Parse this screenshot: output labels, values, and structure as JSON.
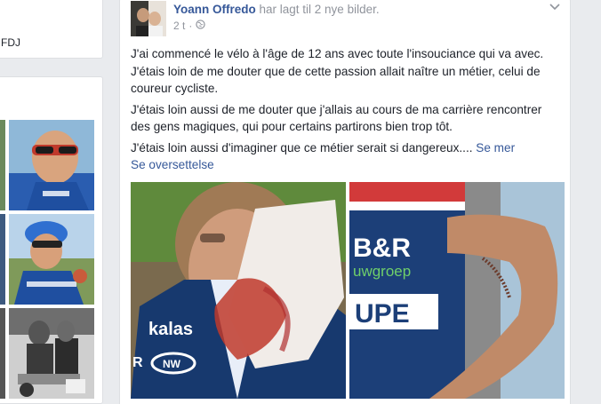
{
  "left": {
    "top_card_text": "FDJ",
    "thumbnails": [
      "cyclist-sunglasses-photo",
      "cyclist-helmet-photo",
      "cyclists-seated-photo"
    ]
  },
  "post": {
    "author": "Yoann Offredo",
    "action": "har lagt til 2 nye bilder.",
    "time": "2 t",
    "separator": "·",
    "paragraphs": [
      "J'ai commencé le vélo à l'âge de 12 ans avec toute l'insouciance qui va avec. J'étais loin de me douter que de cette passion allait naître un métier, celui de coureur cycliste.",
      "J'étais loin aussi de me douter que j'allais au cours de ma carrière rencontrer des gens magiques, qui pour certains partirons bien trop tôt.",
      "J'étais loin aussi d'imaginer que ce métier serait si dangereux...."
    ],
    "see_more": "Se mer",
    "translate": "Se oversettelse",
    "photo_texts": {
      "jersey_brand": "kalas",
      "jersey_nw": "NW",
      "jersey_r": "R",
      "jersey_br": "B&R",
      "jersey_bouwgroep": "uwgroep",
      "jersey_upe": "UPE"
    }
  },
  "colors": {
    "background": "#e9ebee",
    "link": "#365899",
    "text": "#1d2129",
    "meta": "#90949c"
  }
}
